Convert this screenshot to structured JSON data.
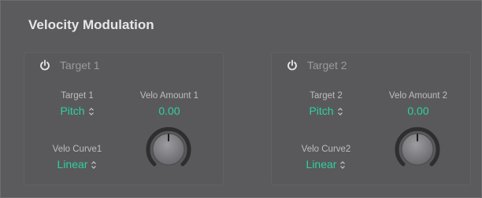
{
  "section": {
    "title": "Velocity Modulation"
  },
  "panels": [
    {
      "title": "Target 1",
      "target_label": "Target 1",
      "target_value": "Pitch",
      "amount_label": "Velo Amount 1",
      "amount_value": "0.00",
      "curve_label": "Velo Curve1",
      "curve_value": "Linear"
    },
    {
      "title": "Target 2",
      "target_label": "Target 2",
      "target_value": "Pitch",
      "amount_label": "Velo Amount 2",
      "amount_value": "0.00",
      "curve_label": "Velo Curve2",
      "curve_value": "Linear"
    }
  ],
  "colors": {
    "accent": "#2fd0a0",
    "background": "#5b5b5e",
    "panel": "#59595c"
  }
}
